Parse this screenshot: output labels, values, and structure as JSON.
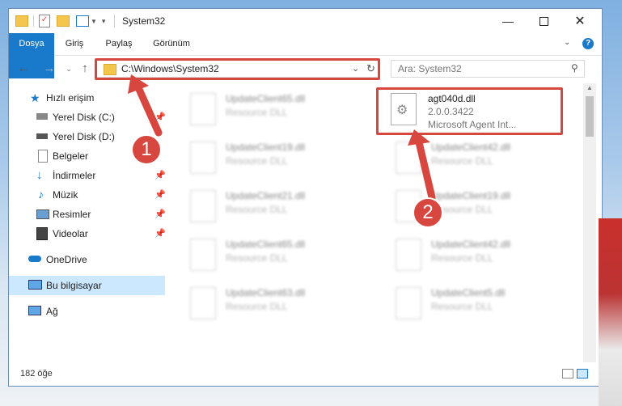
{
  "window": {
    "title": "System32",
    "minimize_icon": "minimize-icon",
    "maximize_icon": "maximize-icon",
    "close_icon": "close-icon"
  },
  "ribbon": {
    "tabs": [
      {
        "label": "Dosya"
      },
      {
        "label": "Giriş"
      },
      {
        "label": "Paylaş"
      },
      {
        "label": "Görünüm"
      }
    ],
    "help_label": "?"
  },
  "address": {
    "path": "C:\\Windows\\System32"
  },
  "search": {
    "placeholder": "Ara: System32"
  },
  "sidebar": {
    "items": [
      {
        "label": "Hızlı erişim"
      },
      {
        "label": "Yerel Disk (C:)"
      },
      {
        "label": "Yerel Disk (D:)"
      },
      {
        "label": "Belgeler"
      },
      {
        "label": "İndirmeler"
      },
      {
        "label": "Müzik"
      },
      {
        "label": "Resimler"
      },
      {
        "label": "Videolar"
      },
      {
        "label": "OneDrive"
      },
      {
        "label": "Bu bilgisayar"
      },
      {
        "label": "Ağ"
      }
    ]
  },
  "files": [
    {
      "name": "UpdateClient65.dll",
      "desc": "Resource DLL"
    },
    {
      "name": "agt040d.dll",
      "version": "2.0.0.3422",
      "desc": "Microsoft Agent Int..."
    },
    {
      "name": "UpdateClient19.dll",
      "desc": "Resource DLL"
    },
    {
      "name": "UpdateClient42.dll",
      "desc": "Resource DLL"
    },
    {
      "name": "UpdateClient21.dll",
      "desc": "Resource DLL"
    },
    {
      "name": "UpdateClient19.dll",
      "desc": "Resource DLL"
    },
    {
      "name": "UpdateClient65.dll",
      "desc": "Resource DLL"
    },
    {
      "name": "UpdateClient42.dll",
      "desc": "Resource DLL"
    },
    {
      "name": "UpdateClient63.dll",
      "desc": "Resource DLL"
    },
    {
      "name": "UpdateClient5.dll",
      "desc": "Resource DLL"
    }
  ],
  "status": {
    "count": "182 öğe"
  },
  "annotations": {
    "step1": "1",
    "step2": "2",
    "color": "#d8473f"
  }
}
